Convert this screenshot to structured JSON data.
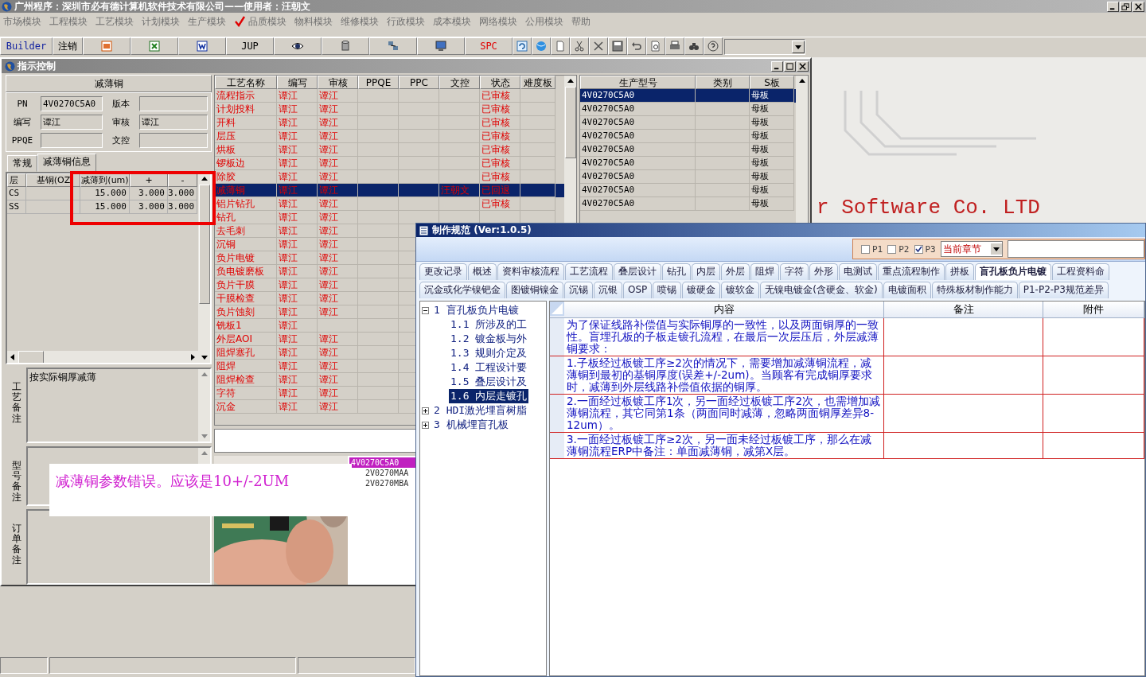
{
  "app": {
    "title": "广州程序：深圳市必有德计算机软件技术有限公司——使用者：汪朝文"
  },
  "menu": [
    {
      "label": "市场模块",
      "checked": false
    },
    {
      "label": "工程模块",
      "checked": false
    },
    {
      "label": "工艺模块",
      "checked": false
    },
    {
      "label": "计划模块",
      "checked": false
    },
    {
      "label": "生产模块",
      "checked": false
    },
    {
      "label": "品质模块",
      "checked": true
    },
    {
      "label": "物料模块",
      "checked": false
    },
    {
      "label": "维修模块",
      "checked": false
    },
    {
      "label": "行政模块",
      "checked": false
    },
    {
      "label": "成本模块",
      "checked": false
    },
    {
      "label": "网络模块",
      "checked": false
    },
    {
      "label": "公用模块",
      "checked": false
    },
    {
      "label": "帮助",
      "checked": false
    }
  ],
  "toolbar": [
    {
      "kind": "text",
      "label": "Builder"
    },
    {
      "kind": "text",
      "label": "注销"
    },
    {
      "kind": "icon"
    },
    {
      "kind": "icon"
    },
    {
      "kind": "icon"
    },
    {
      "kind": "text",
      "label": "JUP"
    },
    {
      "kind": "icon"
    },
    {
      "kind": "icon"
    },
    {
      "kind": "icon"
    },
    {
      "kind": "icon"
    },
    {
      "kind": "text",
      "label": "SPC"
    },
    {
      "kind": "icon"
    },
    {
      "kind": "icon"
    },
    {
      "kind": "icon"
    },
    {
      "kind": "icon"
    },
    {
      "kind": "icon"
    },
    {
      "kind": "icon"
    },
    {
      "kind": "icon"
    },
    {
      "kind": "icon"
    },
    {
      "kind": "icon"
    },
    {
      "kind": "icon"
    },
    {
      "kind": "icon"
    }
  ],
  "child_window": {
    "title": "指示控制"
  },
  "left_panel": {
    "header": "减薄铜",
    "fields": [
      {
        "label": "PN",
        "value": "4V0270C5A0"
      },
      {
        "label": "版本"
      },
      {
        "label": "编写",
        "value": "谭江"
      },
      {
        "label": "审核",
        "value": "谭江"
      },
      {
        "label": "PPQE"
      },
      {
        "label": "文控"
      }
    ],
    "tabs": [
      {
        "label": "常规",
        "selected": false
      },
      {
        "label": "减薄铜信息",
        "selected": true
      }
    ],
    "grid": {
      "columns": [
        "层",
        "基铜(OZ",
        "减薄到(um)",
        "+",
        "-"
      ],
      "rows": [
        [
          "CS",
          "",
          "15.000",
          "3.000",
          "3.000"
        ],
        [
          "SS",
          "",
          "15.000",
          "3.000",
          "3.000"
        ]
      ]
    },
    "notes": [
      {
        "label": "工艺备注",
        "text": "按实际铜厚减薄"
      },
      {
        "label": "型号备注"
      },
      {
        "label": "订单备注"
      }
    ]
  },
  "process_table": {
    "columns": [
      "工艺名称",
      "编写",
      "审核",
      "PPQE",
      "PPC",
      "文控",
      "状态",
      "难度板"
    ],
    "rows": [
      {
        "selected": false,
        "cells": [
          "流程指示",
          "谭江",
          "谭江",
          "",
          "",
          "",
          "已审核",
          ""
        ]
      },
      {
        "selected": false,
        "cells": [
          "计划投料",
          "谭江",
          "谭江",
          "",
          "",
          "",
          "已审核",
          ""
        ]
      },
      {
        "selected": false,
        "cells": [
          "开料",
          "谭江",
          "谭江",
          "",
          "",
          "",
          "已审核",
          ""
        ]
      },
      {
        "selected": false,
        "cells": [
          "层压",
          "谭江",
          "谭江",
          "",
          "",
          "",
          "已审核",
          ""
        ]
      },
      {
        "selected": false,
        "cells": [
          "烘板",
          "谭江",
          "谭江",
          "",
          "",
          "",
          "已审核",
          ""
        ]
      },
      {
        "selected": false,
        "cells": [
          "锣板边",
          "谭江",
          "谭江",
          "",
          "",
          "",
          "已审核",
          ""
        ]
      },
      {
        "selected": false,
        "cells": [
          "除胶",
          "谭江",
          "谭江",
          "",
          "",
          "",
          "已审核",
          ""
        ]
      },
      {
        "selected": true,
        "cells": [
          "减薄铜",
          "谭江",
          "谭江",
          "",
          "",
          "汪朝文",
          "已回退",
          ""
        ]
      },
      {
        "selected": false,
        "cells": [
          "铝片钻孔",
          "谭江",
          "谭江",
          "",
          "",
          "",
          "已审核",
          ""
        ]
      },
      {
        "selected": false,
        "cells": [
          "钻孔",
          "谭江",
          "谭江",
          "",
          "",
          "",
          "",
          ""
        ]
      },
      {
        "selected": false,
        "cells": [
          "去毛刺",
          "谭江",
          "谭江",
          "",
          "",
          "",
          "",
          ""
        ]
      },
      {
        "selected": false,
        "cells": [
          "沉铜",
          "谭江",
          "谭江",
          "",
          "",
          "",
          "",
          ""
        ]
      },
      {
        "selected": false,
        "cells": [
          "负片电镀",
          "谭江",
          "谭江",
          "",
          "",
          "",
          "",
          ""
        ]
      },
      {
        "selected": false,
        "cells": [
          "负电镀磨板",
          "谭江",
          "谭江",
          "",
          "",
          "",
          "",
          ""
        ]
      },
      {
        "selected": false,
        "cells": [
          "负片干膜",
          "谭江",
          "谭江",
          "",
          "",
          "",
          "",
          ""
        ]
      },
      {
        "selected": false,
        "cells": [
          "干膜检查",
          "谭江",
          "谭江",
          "",
          "",
          "",
          "",
          ""
        ]
      },
      {
        "selected": false,
        "cells": [
          "负片蚀刻",
          "谭江",
          "谭江",
          "",
          "",
          "",
          "",
          ""
        ]
      },
      {
        "selected": false,
        "cells": [
          "铣板1",
          "谭江",
          "",
          "",
          "",
          "",
          "",
          ""
        ]
      },
      {
        "selected": false,
        "cells": [
          "外层AOI",
          "谭江",
          "谭江",
          "",
          "",
          "",
          "",
          ""
        ]
      },
      {
        "selected": false,
        "cells": [
          "阻焊塞孔",
          "谭江",
          "谭江",
          "",
          "",
          "",
          "",
          ""
        ]
      },
      {
        "selected": false,
        "cells": [
          "阻焊",
          "谭江",
          "谭江",
          "",
          "",
          "",
          "",
          ""
        ]
      },
      {
        "selected": false,
        "cells": [
          "阻焊检查",
          "谭江",
          "谭江",
          "",
          "",
          "",
          "",
          ""
        ]
      },
      {
        "selected": false,
        "cells": [
          "字符",
          "谭江",
          "谭江",
          "",
          "",
          "",
          "",
          ""
        ]
      },
      {
        "selected": false,
        "cells": [
          "沉金",
          "谭江",
          "谭江",
          "",
          "",
          "",
          "",
          ""
        ]
      }
    ]
  },
  "model_table": {
    "columns": [
      "生产型号",
      "类别",
      "S板"
    ],
    "rows": [
      {
        "selected": true,
        "cells": [
          "4V0270C5A0",
          "",
          "母板"
        ]
      },
      {
        "selected": false,
        "cells": [
          "4V0270C5A0",
          "",
          "母板"
        ]
      },
      {
        "selected": false,
        "cells": [
          "4V0270C5A0",
          "",
          "母板"
        ]
      },
      {
        "selected": false,
        "cells": [
          "4V0270C5A0",
          "",
          "母板"
        ]
      },
      {
        "selected": false,
        "cells": [
          "4V0270C5A0",
          "",
          "母板"
        ]
      },
      {
        "selected": false,
        "cells": [
          "4V0270C5A0",
          "",
          "母板"
        ]
      },
      {
        "selected": false,
        "cells": [
          "4V0270C5A0",
          "",
          "母板"
        ]
      },
      {
        "selected": false,
        "cells": [
          "4V0270C5A0",
          "",
          "母板"
        ]
      },
      {
        "selected": false,
        "cells": [
          "4V0270C5A0",
          "",
          "母板"
        ]
      }
    ]
  },
  "media": {
    "kind": "picture",
    "list": [
      {
        "label": "4V0270C5A0",
        "selected": true
      },
      {
        "label": "2V0270MAA",
        "selected": false
      },
      {
        "label": "2V0270MBA",
        "selected": false
      }
    ]
  },
  "backdrop_text": "r Software Co. LTD",
  "annotation": {
    "text": "减薄铜参数错误。应该是10+/-2UM"
  },
  "dialog": {
    "title": "制作规范 (Ver:1.0.5)",
    "filters": [
      {
        "label": "P1",
        "checked": false
      },
      {
        "label": "P2",
        "checked": false
      },
      {
        "label": "P3",
        "checked": true
      }
    ],
    "scope": "当前章节",
    "tab_rows": [
      [
        {
          "label": "更改记录",
          "selected": false
        },
        {
          "label": "概述",
          "selected": false
        },
        {
          "label": "资料审核流程",
          "selected": false
        },
        {
          "label": "工艺流程",
          "selected": false
        },
        {
          "label": "叠层设计",
          "selected": false
        },
        {
          "label": "钻孔",
          "selected": false
        },
        {
          "label": "内层",
          "selected": false
        },
        {
          "label": "外层",
          "selected": false
        },
        {
          "label": "阻焊",
          "selected": false
        },
        {
          "label": "字符",
          "selected": false
        },
        {
          "label": "外形",
          "selected": false
        },
        {
          "label": "电测试",
          "selected": false
        },
        {
          "label": "重点流程制作",
          "selected": false
        },
        {
          "label": "拼板",
          "selected": false
        },
        {
          "label": "盲孔板负片电镀",
          "selected": true
        },
        {
          "label": "工程资料命",
          "selected": false
        }
      ],
      [
        {
          "label": "沉金或化学镍钯金",
          "selected": false
        },
        {
          "label": "图镀铜镍金",
          "selected": false
        },
        {
          "label": "沉锡",
          "selected": false
        },
        {
          "label": "沉银",
          "selected": false
        },
        {
          "label": "OSP",
          "selected": false
        },
        {
          "label": "喷锡",
          "selected": false
        },
        {
          "label": "镀硬金",
          "selected": false
        },
        {
          "label": "镀软金",
          "selected": false
        },
        {
          "label": "无镍电镀金(含硬金、软金)",
          "selected": false
        },
        {
          "label": "电镀面积",
          "selected": false
        },
        {
          "label": "特殊板材制作能力",
          "selected": false
        },
        {
          "label": "P1-P2-P3规范差异",
          "selected": false
        }
      ]
    ],
    "tree": [
      {
        "label": "1 盲孔板负片电镀",
        "expanded": true,
        "selected": false,
        "children": [
          {
            "label": "1.1 所涉及的工",
            "selected": false
          },
          {
            "label": "1.2 镀金板与外",
            "selected": false
          },
          {
            "label": "1.3 规则介定及",
            "selected": false
          },
          {
            "label": "1.4 工程设计要",
            "selected": false
          },
          {
            "label": "1.5 叠层设计及",
            "selected": false
          },
          {
            "label": "1.6 内层走镀孔",
            "selected": true
          }
        ]
      },
      {
        "label": "2 HDI激光埋盲树脂",
        "expanded": false,
        "selected": false
      },
      {
        "label": "3 机械埋盲孔板",
        "expanded": false,
        "selected": false
      }
    ],
    "grid": {
      "columns": [
        "内容",
        "备注",
        "附件"
      ],
      "rows": [
        [
          "为了保证线路补偿值与实际铜厚的一致性，以及两面铜厚的一致性。盲埋孔板的子板走镀孔流程，在最后一次层压后，外层减薄铜要求：",
          "",
          ""
        ],
        [
          "1.子板经过板镀工序≥2次的情况下，需要增加减薄铜流程，减薄铜到最初的基铜厚度(误差+/-2um)。当顾客有完成铜厚要求时，减薄到外层线路补偿值依据的铜厚。",
          "",
          ""
        ],
        [
          "2.一面经过板镀工序1次，另一面经过板镀工序2次，也需增加减薄铜流程，其它同第1条（两面同时减薄，忽略两面铜厚差异8-12um）。",
          "",
          ""
        ],
        [
          "3.一面经过板镀工序≥2次，另一面未经过板镀工序，那么在减薄铜流程ERP中备注：单面减薄铜，减第X层。",
          "",
          ""
        ]
      ]
    }
  }
}
